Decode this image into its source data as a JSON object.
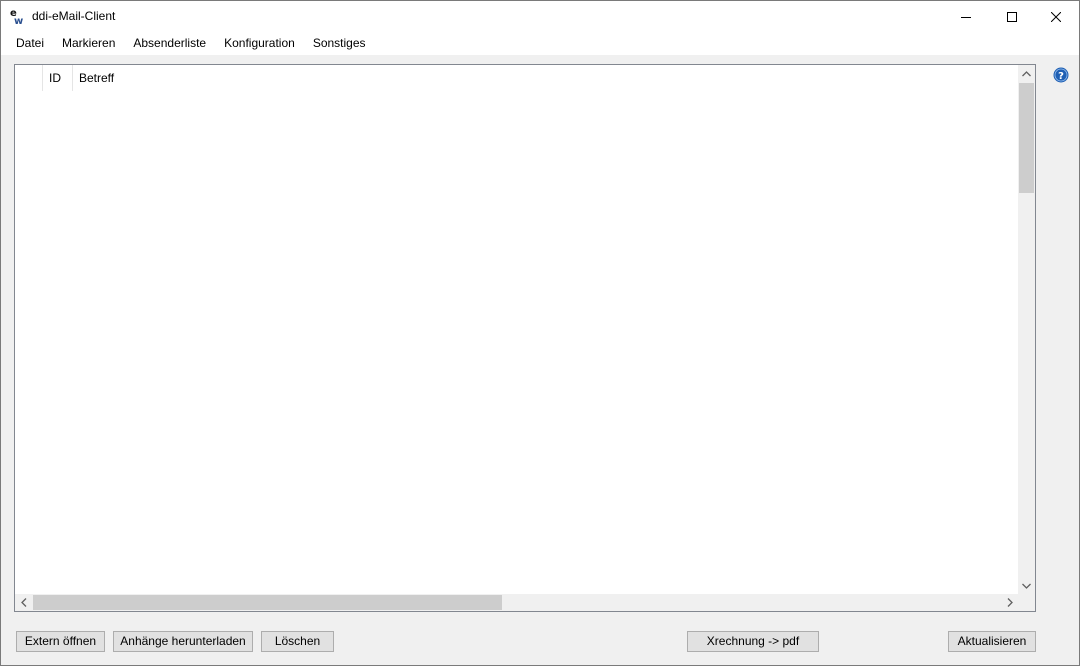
{
  "window": {
    "title": "ddi-eMail-Client",
    "app_icon_letters": "ew"
  },
  "menu": {
    "items": [
      {
        "label": "Datei"
      },
      {
        "label": "Markieren"
      },
      {
        "label": "Absenderliste"
      },
      {
        "label": "Konfiguration"
      },
      {
        "label": "Sonstiges"
      }
    ]
  },
  "grid": {
    "columns": [
      {
        "label": "ID"
      },
      {
        "label": "Betreff"
      }
    ],
    "rows": []
  },
  "buttons": {
    "extern_open": "Extern öffnen",
    "download_attachments": "Anhänge herunterladen",
    "delete": "Löschen",
    "xrechnung_pdf": "Xrechnung -> pdf",
    "refresh": "Aktualisieren"
  },
  "icons": {
    "help": "help-icon",
    "minimize": "minimize-icon",
    "maximize": "maximize-icon",
    "close": "close-icon"
  },
  "colors": {
    "help_blue": "#1e5fb4",
    "button_face": "#e1e1e1",
    "scroll_thumb": "#cdcdcd"
  }
}
